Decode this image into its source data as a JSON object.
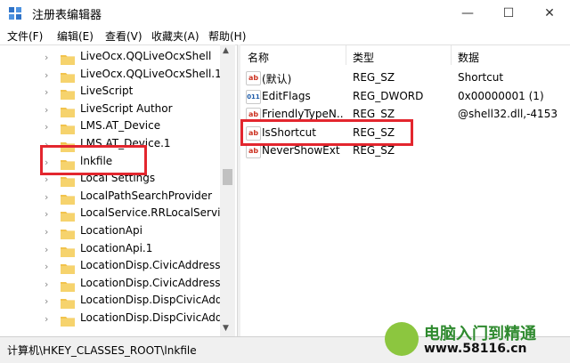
{
  "window": {
    "title": "注册表编辑器",
    "minimize": "—",
    "maximize": "☐",
    "close": "✕"
  },
  "menu": [
    "文件(F)",
    "编辑(E)",
    "查看(V)",
    "收藏夹(A)",
    "帮助(H)"
  ],
  "tree": {
    "items": [
      {
        "label": "LiveOcx.QQLiveOcxShell",
        "expandable": true
      },
      {
        "label": "LiveOcx.QQLiveOcxShell.1",
        "expandable": true
      },
      {
        "label": "LiveScript",
        "expandable": true
      },
      {
        "label": "LiveScript Author",
        "expandable": true
      },
      {
        "label": "LMS.AT_Device",
        "expandable": true
      },
      {
        "label": "LMS.AT_Device.1",
        "expandable": true
      },
      {
        "label": "lnkfile",
        "expandable": true,
        "selected": true
      },
      {
        "label": "Local Settings",
        "expandable": true
      },
      {
        "label": "LocalPathSearchProvider",
        "expandable": true
      },
      {
        "label": "LocalService.RRLocalService",
        "expandable": true
      },
      {
        "label": "LocationApi",
        "expandable": true
      },
      {
        "label": "LocationApi.1",
        "expandable": true
      },
      {
        "label": "LocationDisp.CivicAddressR",
        "expandable": true
      },
      {
        "label": "LocationDisp.CivicAddressR",
        "expandable": true
      },
      {
        "label": "LocationDisp.DispCivicAddre",
        "expandable": true
      },
      {
        "label": "LocationDisp.DispCivicAddre",
        "expandable": true
      }
    ]
  },
  "list": {
    "headers": {
      "name": "名称",
      "type": "类型",
      "data": "数据"
    },
    "rows": [
      {
        "name": "(默认)",
        "type": "REG_SZ",
        "data": "Shortcut",
        "icon": "ab"
      },
      {
        "name": "EditFlags",
        "type": "REG_DWORD",
        "data": "0x00000001 (1)",
        "icon": "bin"
      },
      {
        "name": "FriendlyTypeN...",
        "type": "REG_SZ",
        "data": "@shell32.dll,-4153",
        "icon": "ab"
      },
      {
        "name": "IsShortcut",
        "type": "REG_SZ",
        "data": "",
        "icon": "ab"
      },
      {
        "name": "NeverShowExt",
        "type": "REG_SZ",
        "data": "",
        "icon": "ab"
      }
    ]
  },
  "status": "计算机\\HKEY_CLASSES_ROOT\\lnkfile",
  "watermark": {
    "name": "电脑入门到精通",
    "url": "www.58116.cn"
  },
  "colors": {
    "highlight": "#e3262e",
    "folder": "#f2c34d"
  }
}
